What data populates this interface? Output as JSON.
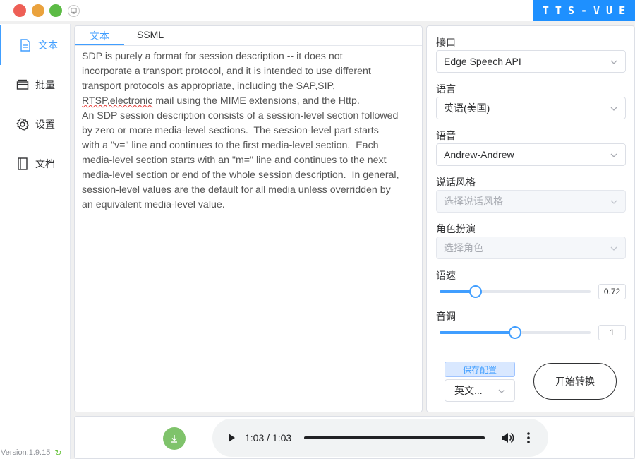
{
  "window": {
    "brand": "TTS-VUE"
  },
  "sidebar": {
    "items": [
      {
        "label": "文本",
        "icon": "document-icon"
      },
      {
        "label": "批量",
        "icon": "batch-icon"
      },
      {
        "label": "设置",
        "icon": "gear-icon"
      },
      {
        "label": "文档",
        "icon": "book-icon"
      }
    ],
    "active": "文本",
    "version": "Version:1.9.15"
  },
  "editor": {
    "tabs": [
      "文本",
      "SSML"
    ],
    "active_tab": "文本",
    "lines": [
      "SDP is purely a format for session description -- it does not",
      "incorporate a transport protocol, and it is intended to use different",
      "transport protocols as appropriate, including the SAP,SIP,",
      "RTSP,electronic mail using the MIME extensions, and the Http.",
      "An SDP session description consists of a session-level section followed",
      "by zero or more media-level sections.  The session-level part starts",
      "with a \"v=\" line and continues to the first media-level section.  Each",
      "media-level section starts with an \"m=\" line and continues to the next",
      "media-level section or end of the whole session description.  In general,",
      "session-level values are the default for all media unless overridden by",
      "an equivalent media-level value."
    ],
    "misspelled_prefix": "RTSP,electronic",
    "line4_rest": " mail using the MIME extensions, and the Http."
  },
  "config": {
    "api_label": "接口",
    "api_value": "Edge Speech API",
    "language_label": "语言",
    "language_value": "英语(美国)",
    "voice_label": "语音",
    "voice_value": "Andrew-Andrew",
    "style_label": "说话风格",
    "style_placeholder": "选择说话风格",
    "role_label": "角色扮演",
    "role_placeholder": "选择角色",
    "rate_label": "语速",
    "rate_value": "0.72",
    "rate_fraction": 0.24,
    "pitch_label": "音调",
    "pitch_value": "1",
    "pitch_fraction": 0.5,
    "save_label": "保存配置",
    "preset_value": "英文...",
    "start_label": "开始转换"
  },
  "player": {
    "time": "1:03 / 1:03",
    "progress": 1.0
  },
  "colors": {
    "accent": "#409eff",
    "brand_bg": "#1e90ff",
    "download": "#7fc36b"
  }
}
